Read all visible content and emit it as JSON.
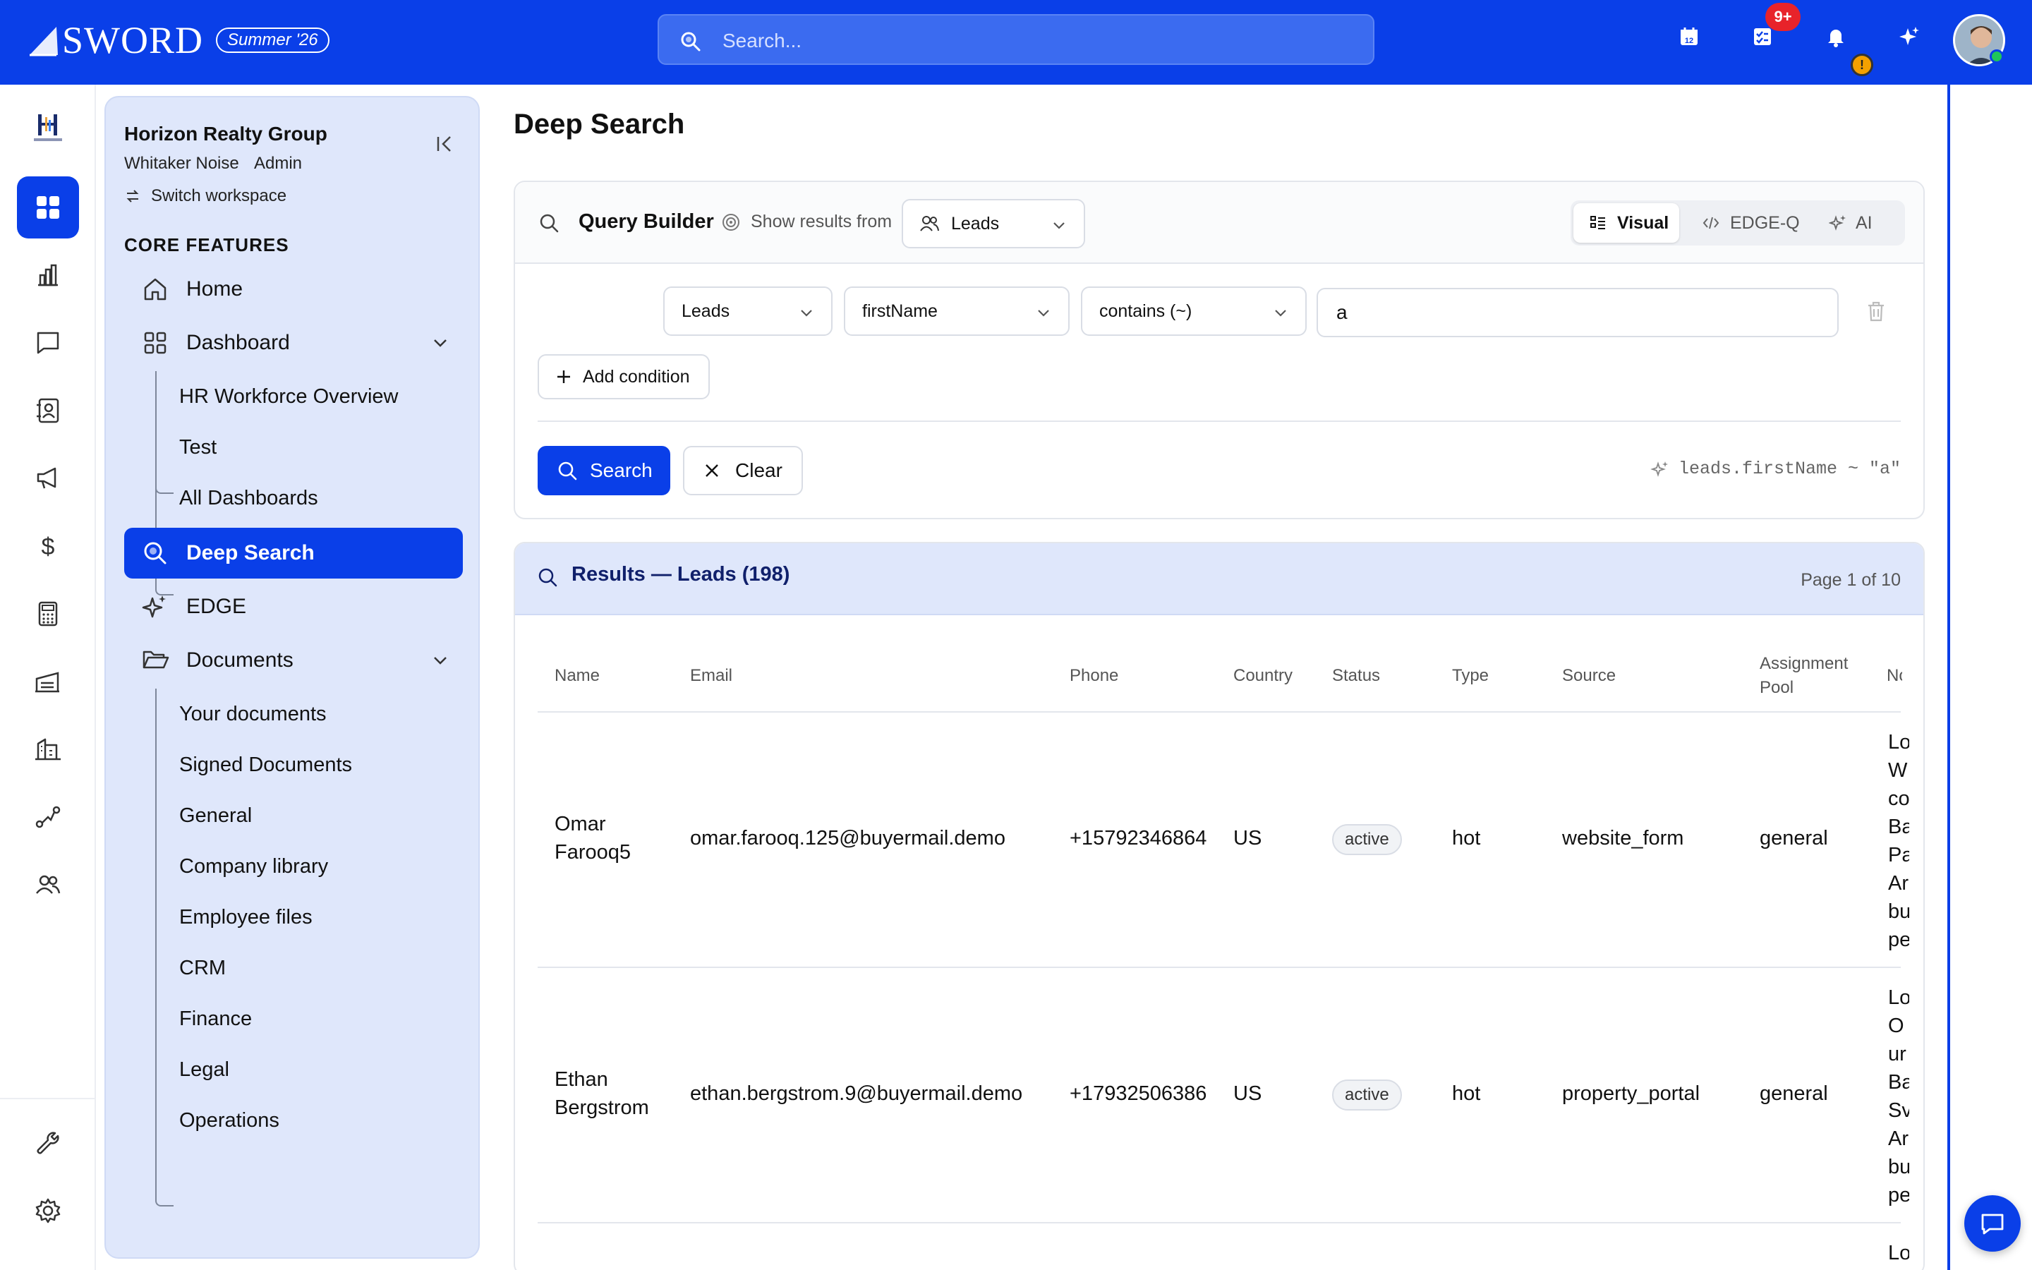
{
  "app": {
    "brand": "SWORD",
    "edition": "Summer '26"
  },
  "topbar": {
    "search_placeholder": "Search...",
    "calendar_day": "12",
    "tasks_badge": "9+",
    "notification_alert": "!"
  },
  "sidebar": {
    "workspace_name": "Horizon Realty Group",
    "user_name": "Whitaker Noise",
    "user_role": "Admin",
    "switch_label": "Switch workspace",
    "section_title": "CORE FEATURES",
    "nav": {
      "home": "Home",
      "dashboard": "Dashboard",
      "deep_search": "Deep Search",
      "edge": "EDGE",
      "documents": "Documents"
    },
    "dashboard_children": [
      "HR Workforce Overview",
      "Test",
      "All Dashboards"
    ],
    "documents_children": [
      "Your documents",
      "Signed Documents",
      "General",
      "Company library",
      "Employee files",
      "CRM",
      "Finance",
      "Legal",
      "Operations"
    ]
  },
  "page": {
    "title": "Deep Search"
  },
  "query_builder": {
    "label": "Query Builder",
    "show_results_label": "Show results from",
    "source": "Leads",
    "modes": [
      "Visual",
      "EDGE-Q",
      "AI"
    ],
    "active_mode": "Visual",
    "condition": {
      "entity": "Leads",
      "field": "firstName",
      "operator": "contains (~)",
      "value": "a"
    },
    "add_condition_label": "Add condition",
    "search_label": "Search",
    "clear_label": "Clear",
    "query_string": "leads.firstName ~ \"a\""
  },
  "results": {
    "title": "Results — Leads (198)",
    "page_info": "Page 1 of 10",
    "columns": [
      "Name",
      "Email",
      "Phone",
      "Country",
      "Status",
      "Type",
      "Source",
      "Assignment Pool",
      "Notes"
    ],
    "rows": [
      {
        "name_first": "Omar",
        "name_last": "Farooq5",
        "email": "omar.farooq.125@buyermail.demo",
        "phone": "+15792346864",
        "country": "US",
        "status": "active",
        "type": "hot",
        "source": "website_form",
        "pool": "general",
        "notes": "Lo W co Ba Pa Ar bu pe"
      },
      {
        "name_first": "Ethan",
        "name_last": "Bergstrom",
        "email": "ethan.bergstrom.9@buyermail.demo",
        "phone": "+17932506386",
        "country": "US",
        "status": "active",
        "type": "hot",
        "source": "property_portal",
        "pool": "general",
        "notes": "Lo O ur Ba Sv Ar bu pe"
      },
      {
        "notes": "Lo"
      }
    ]
  },
  "colors": {
    "primary": "#0a3fe8",
    "sidebar_bg": "#dfe7fb",
    "badge_red": "#e8232a"
  }
}
